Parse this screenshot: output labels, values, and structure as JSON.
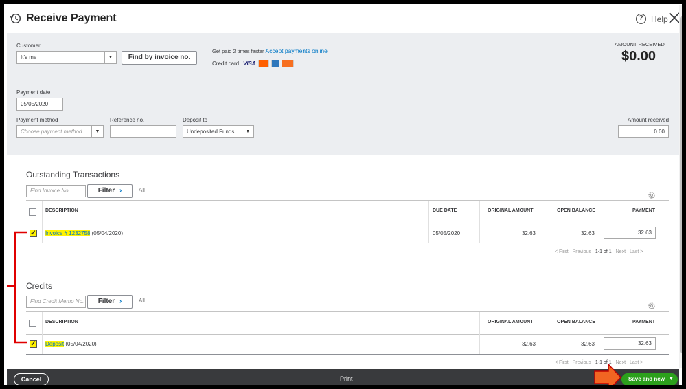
{
  "header": {
    "title": "Receive Payment",
    "help_label": "Help"
  },
  "customer": {
    "label": "Customer",
    "value": "It's me",
    "find_invoice_label": "Find by invoice no."
  },
  "promo": {
    "text": "Get paid 2 times faster",
    "link": "Accept payments online",
    "credit_card_label": "Credit card",
    "card_brands": [
      "VISA",
      "mastercard",
      "amex",
      "discover"
    ]
  },
  "amount_received_top": {
    "label": "AMOUNT RECEIVED",
    "value": "$0.00"
  },
  "payment_date": {
    "label": "Payment date",
    "value": "05/05/2020"
  },
  "payment_method": {
    "label": "Payment method",
    "placeholder": "Choose payment method"
  },
  "reference": {
    "label": "Reference no.",
    "value": ""
  },
  "deposit_to": {
    "label": "Deposit to",
    "value": "Undeposited Funds"
  },
  "amount_received": {
    "label": "Amount received",
    "value": "0.00"
  },
  "outstanding": {
    "title": "Outstanding Transactions",
    "search_placeholder": "Find Invoice No.",
    "filter_label": "Filter",
    "all_label": "All",
    "columns": [
      "DESCRIPTION",
      "DUE DATE",
      "ORIGINAL AMOUNT",
      "OPEN BALANCE",
      "PAYMENT"
    ],
    "rows": [
      {
        "checked": true,
        "description_highlight": "Invoice # 1232758",
        "description_rest": " (05/04/2020)",
        "due_date": "05/05/2020",
        "original_amount": "32.63",
        "open_balance": "32.63",
        "payment": "32.63"
      }
    ],
    "pager": {
      "first": "< First",
      "previous": "Previous",
      "range": "1-1 of 1",
      "next": "Next",
      "last": "Last >"
    }
  },
  "credits": {
    "title": "Credits",
    "search_placeholder": "Find Credit Memo No.",
    "filter_label": "Filter",
    "all_label": "All",
    "columns": [
      "DESCRIPTION",
      "ORIGINAL AMOUNT",
      "OPEN BALANCE",
      "PAYMENT"
    ],
    "rows": [
      {
        "checked": true,
        "description_highlight": "Deposit",
        "description_rest": " (05/04/2020)",
        "original_amount": "32.63",
        "open_balance": "32.63",
        "payment": "32.63"
      }
    ],
    "pager": {
      "first": "< First",
      "previous": "Previous",
      "range": "1-1 of 1",
      "next": "Next",
      "last": "Last >"
    }
  },
  "footer": {
    "cancel_label": "Cancel",
    "print_label": "Print",
    "save_label": "Save and new"
  },
  "colors": {
    "accent_green": "#2ca01c",
    "link_blue": "#0077c5",
    "highlight_yellow": "#fff200",
    "annotation_red": "#e00000",
    "annotation_orange": "#f26522"
  }
}
